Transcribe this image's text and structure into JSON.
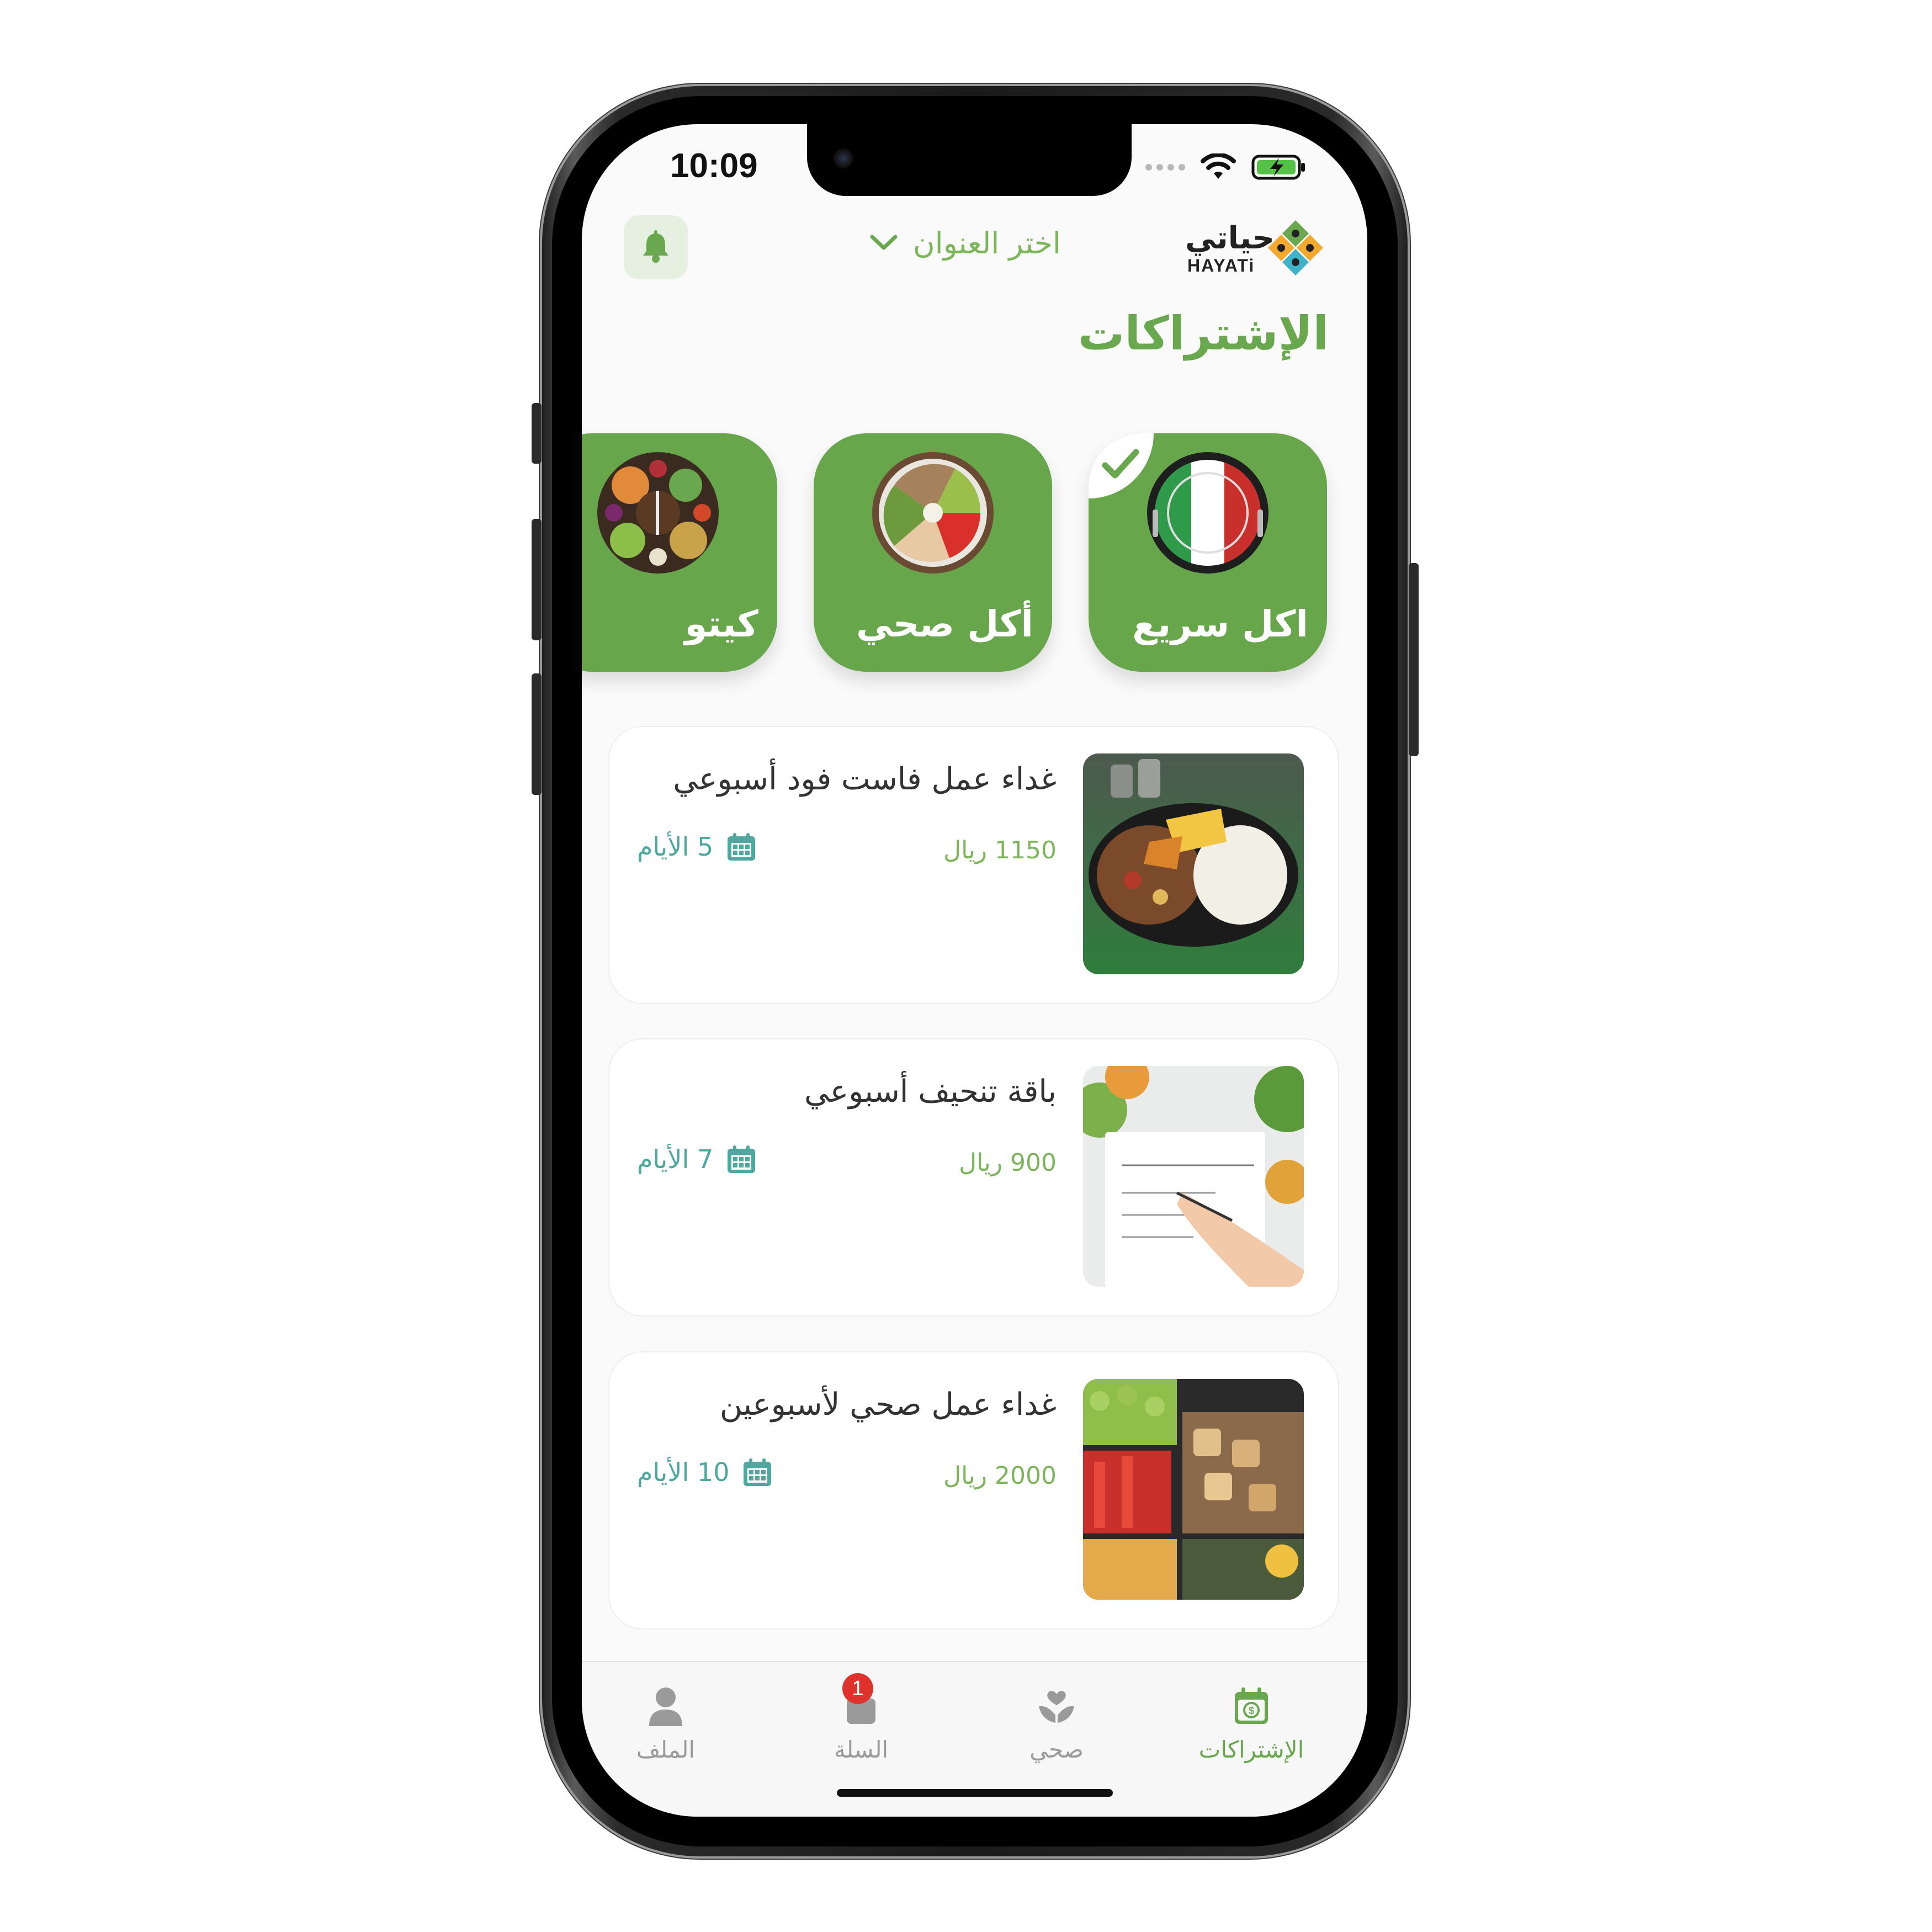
{
  "status_bar": {
    "time": "10:09"
  },
  "header": {
    "address_placeholder": "اختر العنوان",
    "logo_ar": "حياتي",
    "logo_en": "HAYATi"
  },
  "page_title": "الإشتراكات",
  "categories": [
    {
      "label": "اكل سريع",
      "selected": true
    },
    {
      "label": "أكل صحي",
      "selected": false
    },
    {
      "label": "كيتو",
      "selected": false
    }
  ],
  "subscriptions": [
    {
      "title": "غداء عمل فاست فود أسبوعي",
      "price": "1150 ريال",
      "days": "5 الأيام"
    },
    {
      "title": "باقة تنحيف أسبوعي",
      "price": "900 ريال",
      "days": "7 الأيام"
    },
    {
      "title": "غداء عمل صحي لأسبوعين",
      "price": "2000 ريال",
      "days": "10 الأيام"
    }
  ],
  "tabs": [
    {
      "label": "الإشتراكات",
      "icon": "calendar-dollar-icon",
      "active": true
    },
    {
      "label": "صحي",
      "icon": "hand-heart-icon",
      "active": false
    },
    {
      "label": "السلة",
      "icon": "shopping-bag-icon",
      "active": false,
      "badge": "1"
    },
    {
      "label": "الملف",
      "icon": "user-icon",
      "active": false
    }
  ],
  "colors": {
    "primary_green": "#67a64a",
    "price_green": "#7db55b",
    "teal": "#4ea8a0",
    "badge_red": "#e0322c"
  }
}
